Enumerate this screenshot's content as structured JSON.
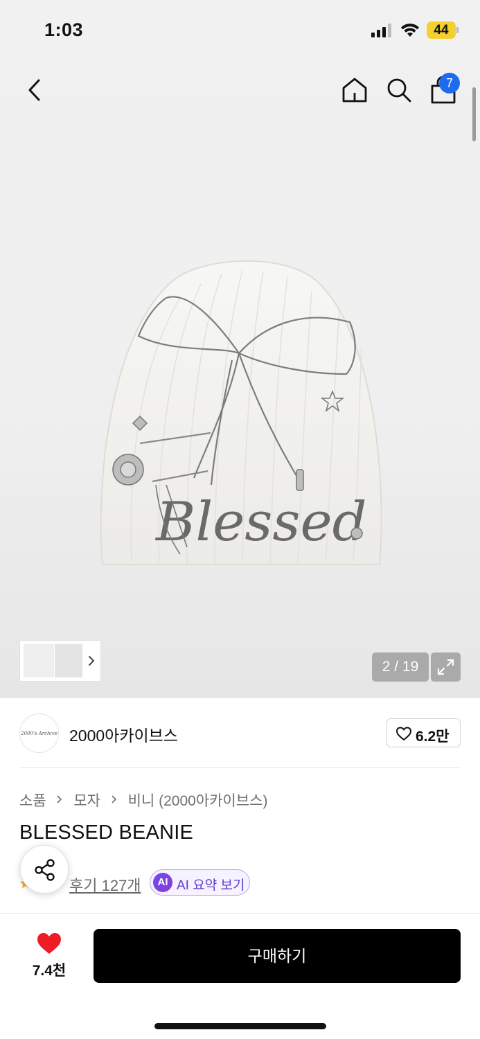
{
  "status_bar": {
    "time": "1:03",
    "battery": "44"
  },
  "nav": {
    "cart_count": "7"
  },
  "gallery": {
    "page_indicator": "2 / 19"
  },
  "shop": {
    "logo_text": "2000's Archive",
    "name": "2000아카이브스",
    "likes": "6.2만"
  },
  "breadcrumb": [
    "소품",
    "모자",
    "비니 (2000아카이브스)"
  ],
  "product": {
    "title": "BLESSED BEANIE",
    "review_label": "후기 127개",
    "ai_badge": "AI",
    "ai_label": "AI 요약 보기"
  },
  "bottom_bar": {
    "wish_count": "7.4천",
    "buy_label": "구매하기"
  },
  "colors": {
    "accent_blue": "#1d6cf0",
    "heart_red": "#ee1c25",
    "ai_purple": "#5b3fd2",
    "battery_yellow": "#f5cf2e"
  }
}
